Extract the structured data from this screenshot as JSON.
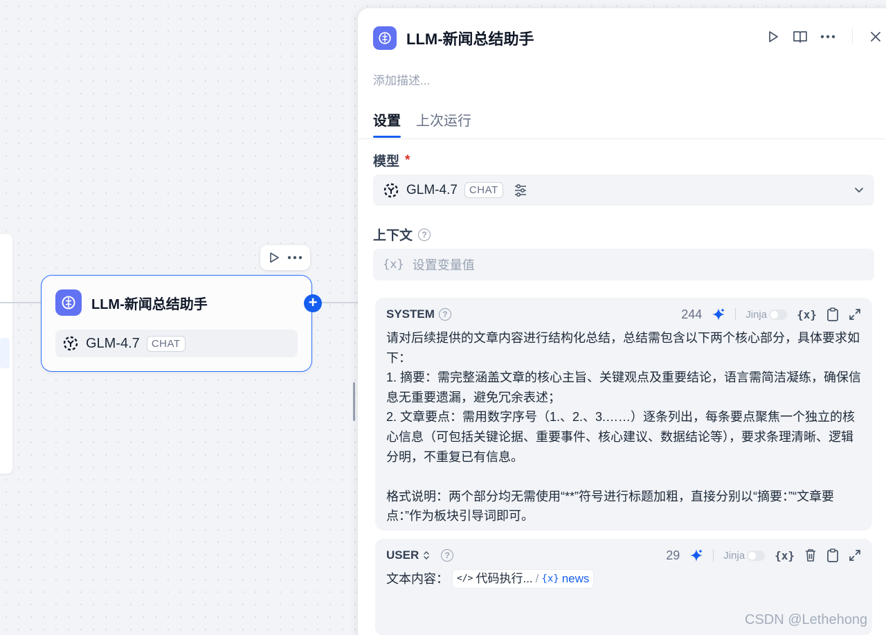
{
  "canvas": {
    "node": {
      "title": "LLM-新闻总结助手",
      "model": "GLM-4.7",
      "model_badge": "CHAT"
    }
  },
  "panel": {
    "title": "LLM-新闻总结助手",
    "description_placeholder": "添加描述...",
    "tabs": [
      {
        "label": "设置",
        "active": true
      },
      {
        "label": "上次运行",
        "active": false
      }
    ],
    "model_section": {
      "label": "模型",
      "required_mark": "*",
      "model": "GLM-4.7",
      "badge": "CHAT"
    },
    "context_section": {
      "label": "上下文",
      "help": "?",
      "var_icon": "{x}",
      "placeholder": "设置变量值"
    },
    "system_prompt": {
      "role": "SYSTEM",
      "count": "244",
      "jinja_label": "Jinja",
      "var_button": "{x}",
      "lines": [
        "请对后续提供的文章内容进行结构化总结，总结需包含以下两个核心部分，具体要求如下：",
        "1. 摘要：需完整涵盖文章的核心主旨、关键观点及重要结论，语言需简洁凝练，确保信息无重要遗漏，避免冗余表述；",
        "2. 文章要点：需用数字序号（1.、2.、3.……）逐条列出，每条要点聚焦一个独立的核心信息（可包括关键论据、重要事件、核心建议、数据结论等），要求条理清晰、逻辑分明，不重复已有信息。",
        "",
        "格式说明：两个部分均无需使用“**”符号进行标题加粗，直接分别以“摘要：”“文章要点：”作为板块引导词即可。"
      ]
    },
    "user_prompt": {
      "role": "USER",
      "count": "29",
      "jinja_label": "Jinja",
      "var_button": "{x}",
      "prefix": "文本内容：",
      "variable": {
        "source_icon": "</>",
        "source": "代码执行...",
        "separator": "/",
        "var_icon": "{x}",
        "name": "news"
      }
    }
  },
  "watermark": "CSDN @Lethehong",
  "colors": {
    "accent": "#155eef",
    "llm_icon_bg": "#6172f3",
    "star": "#155eef",
    "required": "#d92d20"
  }
}
